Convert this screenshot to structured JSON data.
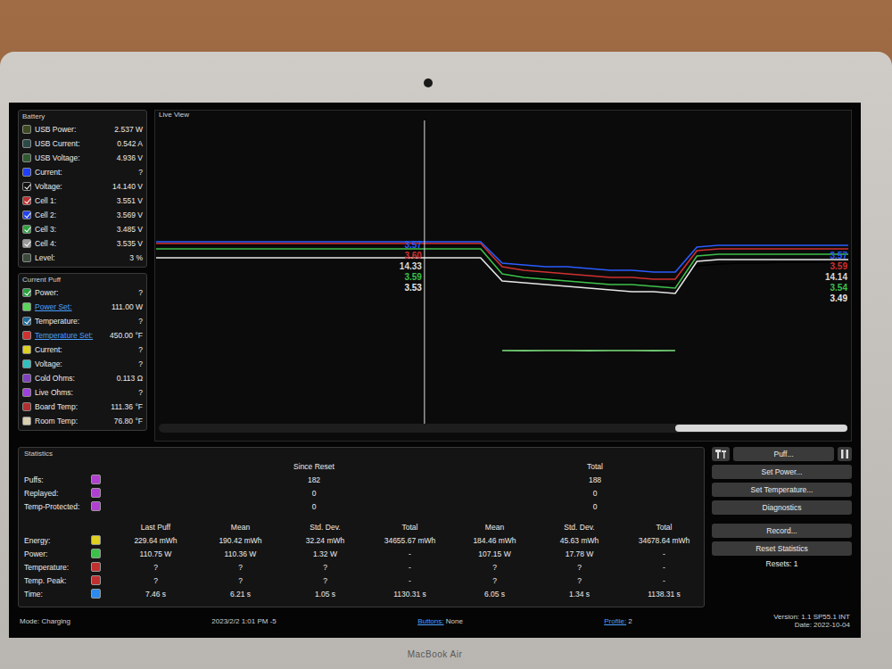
{
  "device": {
    "brand": "MacBook Air"
  },
  "battery": {
    "title": "Battery",
    "items": [
      {
        "label": "USB Power:",
        "value": "2.537 W",
        "checked": false,
        "color": "#3d4a1f",
        "kind": "plain"
      },
      {
        "label": "USB Current:",
        "value": "0.542 A",
        "checked": false,
        "color": "#2a4a4a",
        "kind": "plain"
      },
      {
        "label": "USB Voltage:",
        "value": "4.936 V",
        "checked": false,
        "color": "#2f5a2f",
        "kind": "plain"
      },
      {
        "label": "Current:",
        "value": "?",
        "checked": false,
        "color": "#1f3fff",
        "kind": "plain"
      },
      {
        "label": "Voltage:",
        "value": "14.140 V",
        "checked": true,
        "color": "#111111",
        "kind": "plain"
      },
      {
        "label": "Cell 1:",
        "value": "3.551 V",
        "checked": true,
        "color": "#c03030",
        "kind": "plain"
      },
      {
        "label": "Cell 2:",
        "value": "3.569 V",
        "checked": true,
        "color": "#2244ee",
        "kind": "plain"
      },
      {
        "label": "Cell 3:",
        "value": "3.485 V",
        "checked": true,
        "color": "#30a040",
        "kind": "plain"
      },
      {
        "label": "Cell 4:",
        "value": "3.535 V",
        "checked": true,
        "color": "#9a9a9a",
        "kind": "plain"
      },
      {
        "label": "Level:",
        "value": "3 %",
        "checked": false,
        "color": "#3a4a3a",
        "kind": "plain"
      }
    ]
  },
  "current_puff": {
    "title": "Current Puff",
    "items": [
      {
        "label": "Power:",
        "value": "?",
        "checked": true,
        "color": "#2aa040",
        "kind": "plain"
      },
      {
        "label": "Power Set:",
        "value": "111.00 W",
        "checked": false,
        "color": "#5ad45a",
        "kind": "link"
      },
      {
        "label": "Temperature:",
        "value": "?",
        "checked": true,
        "color": "#1e6a9a",
        "kind": "plain"
      },
      {
        "label": "Temperature Set:",
        "value": "450.00 °F",
        "checked": false,
        "color": "#d03030",
        "kind": "link"
      },
      {
        "label": "Current:",
        "value": "?",
        "checked": false,
        "color": "#e0d020",
        "kind": "plain"
      },
      {
        "label": "Voltage:",
        "value": "?",
        "checked": false,
        "color": "#30c0c0",
        "kind": "plain"
      },
      {
        "label": "Cold Ohms:",
        "value": "0.113 Ω",
        "checked": false,
        "color": "#8040c0",
        "kind": "plain"
      },
      {
        "label": "Live Ohms:",
        "value": "?",
        "checked": false,
        "color": "#a040e0",
        "kind": "plain"
      },
      {
        "label": "Board Temp:",
        "value": "111.36 °F",
        "checked": false,
        "color": "#b03030",
        "kind": "plain"
      },
      {
        "label": "Room Temp:",
        "value": "76.80 °F",
        "checked": false,
        "color": "#d8d0b0",
        "kind": "plain"
      }
    ]
  },
  "live_view": {
    "title": "Live View",
    "cursor_position": 0.387,
    "scrollbar": {
      "level": 0.25
    },
    "series": [
      {
        "name": "Cell 2",
        "kind": "cell",
        "color": "#2a5cff",
        "cursor_label": "3.57",
        "end_label": "3.57",
        "values": [
          3.57,
          3.57,
          3.57,
          3.57,
          3.57,
          3.57,
          3.57,
          3.57,
          3.57,
          3.57,
          3.57,
          3.57,
          3.57,
          3.57,
          3.57,
          3.57,
          3.51,
          3.505,
          3.5,
          3.5,
          3.495,
          3.49,
          3.49,
          3.485,
          3.485,
          3.555,
          3.56,
          3.56,
          3.56,
          3.56,
          3.56,
          3.56,
          3.56
        ]
      },
      {
        "name": "Cell 1",
        "kind": "cell",
        "color": "#d03030",
        "cursor_label": "3.60",
        "end_label": "3.59",
        "values": [
          3.565,
          3.565,
          3.565,
          3.565,
          3.565,
          3.565,
          3.565,
          3.565,
          3.565,
          3.565,
          3.565,
          3.565,
          3.565,
          3.565,
          3.565,
          3.565,
          3.5,
          3.49,
          3.485,
          3.48,
          3.475,
          3.47,
          3.47,
          3.465,
          3.465,
          3.545,
          3.55,
          3.55,
          3.55,
          3.55,
          3.55,
          3.55,
          3.55
        ]
      },
      {
        "name": "Voltage",
        "kind": "pack",
        "color": "#000000",
        "cursor_label": "14.33",
        "end_label": "14.14",
        "values": [
          14.33,
          14.33,
          14.33,
          14.33,
          14.33,
          14.33,
          14.33,
          14.33,
          14.33,
          14.33,
          14.33,
          14.33,
          14.33,
          14.33,
          14.33,
          14.33,
          14.02,
          13.99,
          13.97,
          13.95,
          13.93,
          13.92,
          13.91,
          13.9,
          13.89,
          14.1,
          14.12,
          14.13,
          14.13,
          14.14,
          14.14,
          14.14,
          14.14
        ]
      },
      {
        "name": "Cell 3",
        "kind": "cell",
        "color": "#3cc04a",
        "cursor_label": "3.59",
        "end_label": "3.54",
        "values": [
          3.55,
          3.55,
          3.55,
          3.55,
          3.55,
          3.55,
          3.55,
          3.55,
          3.55,
          3.55,
          3.55,
          3.55,
          3.55,
          3.55,
          3.55,
          3.55,
          3.48,
          3.47,
          3.465,
          3.46,
          3.455,
          3.45,
          3.45,
          3.445,
          3.44,
          3.53,
          3.535,
          3.535,
          3.535,
          3.535,
          3.535,
          3.535,
          3.535
        ]
      },
      {
        "name": "Cell 4",
        "kind": "cell",
        "color": "#e6e6e6",
        "cursor_label": "3.53",
        "end_label": "3.49",
        "values": [
          3.525,
          3.525,
          3.525,
          3.525,
          3.525,
          3.525,
          3.525,
          3.525,
          3.525,
          3.525,
          3.525,
          3.525,
          3.525,
          3.525,
          3.525,
          3.525,
          3.46,
          3.455,
          3.45,
          3.445,
          3.44,
          3.435,
          3.43,
          3.43,
          3.425,
          3.515,
          3.52,
          3.52,
          3.52,
          3.52,
          3.52,
          3.52,
          3.52
        ]
      },
      {
        "name": "Power",
        "kind": "power",
        "color": "#7de07d",
        "values": [
          null,
          null,
          null,
          null,
          null,
          null,
          null,
          null,
          null,
          null,
          null,
          null,
          null,
          null,
          null,
          null,
          110.8,
          110.7,
          110.75,
          110.8,
          110.7,
          110.75,
          110.8,
          110.7,
          110.75,
          null,
          null,
          null,
          null,
          null,
          null,
          null,
          null
        ]
      }
    ]
  },
  "statistics": {
    "title": "Statistics",
    "counts": {
      "headers": [
        "Since Reset",
        "Total"
      ],
      "rows": [
        {
          "label": "Puffs:",
          "color": "#b040d0",
          "values": [
            "182",
            "188"
          ]
        },
        {
          "label": "Replayed:",
          "color": "#b040d0",
          "values": [
            "0",
            "0"
          ]
        },
        {
          "label": "Temp-Protected:",
          "color": "#b040d0",
          "values": [
            "0",
            "0"
          ]
        }
      ]
    },
    "table": {
      "columns": [
        "Last Puff",
        "Mean",
        "Std. Dev.",
        "Total",
        "Mean",
        "Std. Dev.",
        "Total"
      ],
      "rows": [
        {
          "label": "Energy:",
          "color": "#e0d020",
          "cells": [
            "229.64 mWh",
            "190.42 mWh",
            "32.24 mWh",
            "34655.67 mWh",
            "184.46 mWh",
            "45.63 mWh",
            "34678.64 mWh"
          ]
        },
        {
          "label": "Power:",
          "color": "#3cc04a",
          "cells": [
            "110.75 W",
            "110.36 W",
            "1.32 W",
            "-",
            "107.15 W",
            "17.78 W",
            "-"
          ]
        },
        {
          "label": "Temperature:",
          "color": "#c03030",
          "cells": [
            "?",
            "?",
            "?",
            "-",
            "?",
            "?",
            "-"
          ]
        },
        {
          "label": "Temp. Peak:",
          "color": "#c03030",
          "cells": [
            "?",
            "?",
            "?",
            "-",
            "?",
            "?",
            "-"
          ]
        },
        {
          "label": "Time:",
          "color": "#2a8aee",
          "cells": [
            "7.46 s",
            "6.21 s",
            "1.05 s",
            "1130.31 s",
            "6.05 s",
            "1.34 s",
            "1138.31 s"
          ]
        }
      ]
    }
  },
  "controls": {
    "puff": "Puff...",
    "buttons": [
      "Set Power...",
      "Set Temperature...",
      "Diagnostics",
      "Record...",
      "Reset Statistics"
    ],
    "resets": "Resets: 1"
  },
  "status_bar": {
    "mode": "Mode: Charging",
    "datetime": "2023/2/2 1:01 PM -5",
    "buttons_label": "Buttons:",
    "buttons_value": "None",
    "profile_label": "Profile:",
    "profile_value": "2",
    "version": "Version: 1.1 SP55.1 INT",
    "date": "Date: 2022-10-04"
  }
}
